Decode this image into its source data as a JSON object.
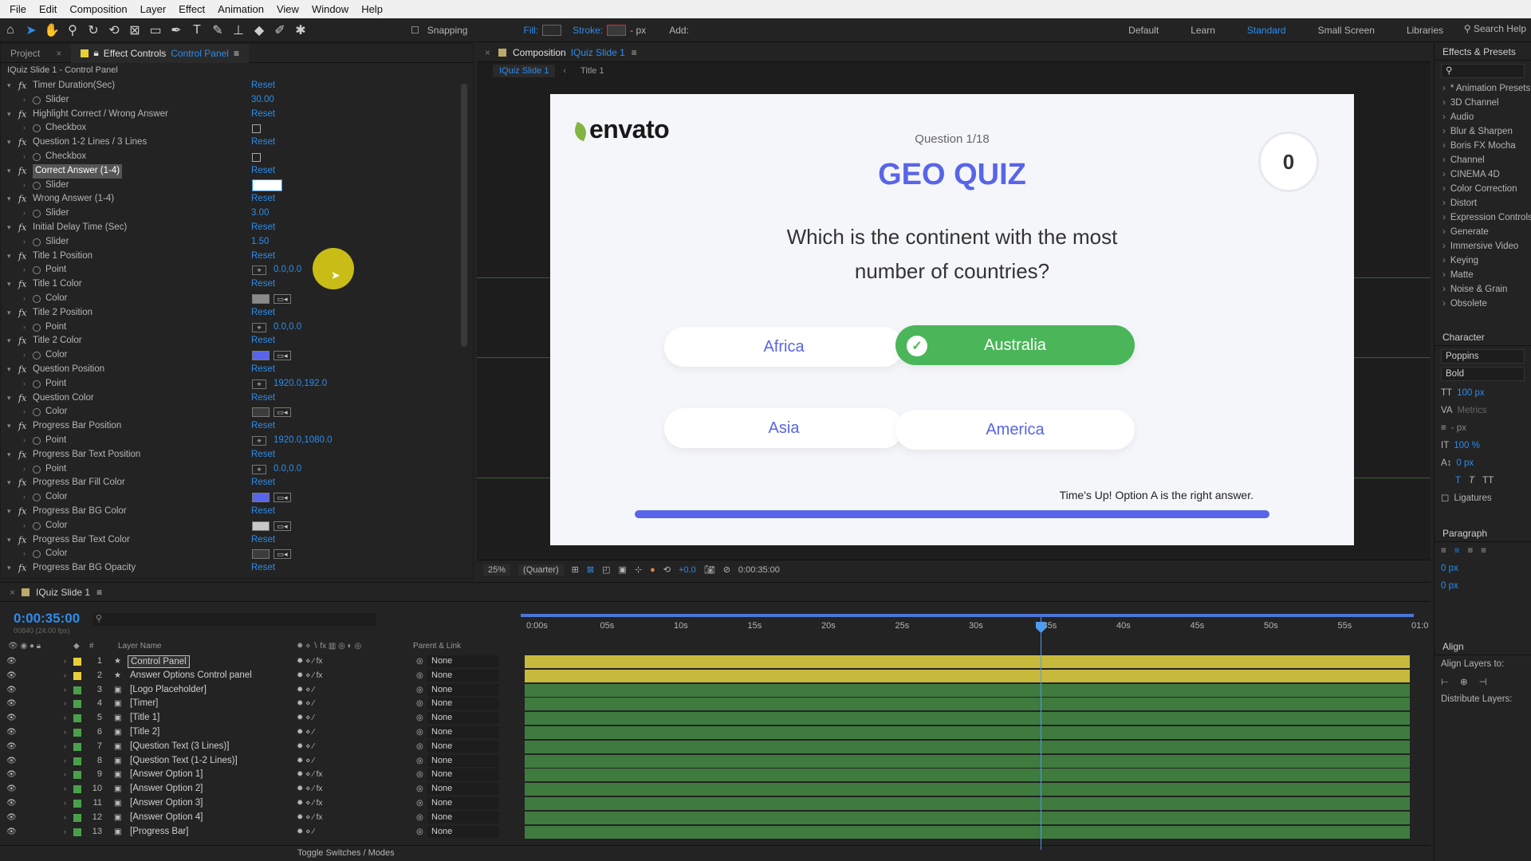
{
  "menu": [
    "File",
    "Edit",
    "Composition",
    "Layer",
    "Effect",
    "Animation",
    "View",
    "Window",
    "Help"
  ],
  "toolbar": {
    "snapping": "Snapping",
    "fill": "Fill:",
    "stroke": "Stroke:",
    "px": "- px",
    "add": "Add:",
    "workspaces": [
      "Default",
      "Learn",
      "Standard",
      "Small Screen",
      "Libraries"
    ],
    "active_workspace": "Standard",
    "search_help": "Search Help"
  },
  "effect_controls": {
    "tab_project": "Project",
    "tab_label": "Effect Controls",
    "tab_layer": "Control Panel",
    "layer_title": "IQuiz Slide 1 - Control Panel",
    "reset": "Reset",
    "effects": [
      {
        "name": "Timer Duration(Sec)",
        "prop": "Slider",
        "type": "value",
        "value": "30.00"
      },
      {
        "name": "Highlight Correct / Wrong Answer",
        "prop": "Checkbox",
        "type": "checkbox"
      },
      {
        "name": "Question 1-2 Lines / 3 Lines",
        "prop": "Checkbox",
        "type": "checkbox"
      },
      {
        "name": "Correct Answer (1-4)",
        "prop": "Slider",
        "type": "editing",
        "highlight": true
      },
      {
        "name": "Wrong Answer (1-4)",
        "prop": "Slider",
        "type": "value",
        "value": "3.00"
      },
      {
        "name": "Initial Delay Time (Sec)",
        "prop": "Slider",
        "type": "value",
        "value": "1.50"
      },
      {
        "name": "Title 1 Position",
        "prop": "Point",
        "type": "point",
        "value": "0.0,0.0"
      },
      {
        "name": "Title 1 Color",
        "prop": "Color",
        "type": "color",
        "color": "#8a8a8a"
      },
      {
        "name": "Title 2 Position",
        "prop": "Point",
        "type": "point",
        "value": "0.0,0.0"
      },
      {
        "name": "Title 2 Color",
        "prop": "Color",
        "type": "color",
        "color": "#5865e8"
      },
      {
        "name": "Question Position",
        "prop": "Point",
        "type": "point",
        "value": "1920.0,192.0"
      },
      {
        "name": "Question Color",
        "prop": "Color",
        "type": "color",
        "color": "#3c3c3c"
      },
      {
        "name": "Progress Bar Position",
        "prop": "Point",
        "type": "point",
        "value": "1920.0,1080.0"
      },
      {
        "name": "Progress Bar Text Position",
        "prop": "Point",
        "type": "point",
        "value": "0.0,0.0"
      },
      {
        "name": "Progress Bar Fill Color",
        "prop": "Color",
        "type": "color",
        "color": "#5865e8"
      },
      {
        "name": "Progress Bar BG Color",
        "prop": "Color",
        "type": "color",
        "color": "#c8c8c8"
      },
      {
        "name": "Progress Bar Text Color",
        "prop": "Color",
        "type": "color",
        "color": "#3c3c3c"
      },
      {
        "name": "Progress Bar BG Opacity",
        "prop": "",
        "type": "none"
      }
    ]
  },
  "composition": {
    "tab_label": "Composition",
    "comp_name": "IQuiz Slide 1",
    "crumb_active": "IQuiz Slide 1",
    "crumb_next": "Title 1",
    "zoom": "25%",
    "resolution": "(Quarter)",
    "exposure": "+0.0",
    "timecode": "0:00:35:00"
  },
  "quiz": {
    "logo": "envato",
    "question_count": "Question 1/18",
    "title": "GEO QUIZ",
    "score": "0",
    "question_line1": "Which is the continent with the most",
    "question_line2": "number of countries?",
    "options": [
      "Africa",
      "Australia",
      "Asia",
      "America"
    ],
    "correct_option": "Australia",
    "answer_text": "Time's Up! Option A is the right answer.",
    "accent": "#5865e8",
    "correct_color": "#4ab659"
  },
  "effects_presets": {
    "title": "Effects & Presets",
    "items": [
      "* Animation Presets",
      "3D Channel",
      "Audio",
      "Blur & Sharpen",
      "Boris FX Mocha",
      "Channel",
      "CINEMA 4D",
      "Color Correction",
      "Distort",
      "Expression Controls",
      "Generate",
      "Immersive Video",
      "Keying",
      "Matte",
      "Noise & Grain",
      "Obsolete"
    ]
  },
  "character": {
    "title": "Character",
    "font": "Poppins",
    "style": "Bold",
    "size": "100 px",
    "metrics": "Metrics",
    "px": "- px",
    "vscale": "100 %",
    "baseline": "0 px",
    "ligatures": "Ligatures"
  },
  "paragraph": {
    "title": "Paragraph",
    "indent1": "0 px",
    "indent2": "0 px"
  },
  "align": {
    "title": "Align",
    "align_to": "Align Layers to:",
    "distribute": "Distribute Layers:"
  },
  "timeline": {
    "tab": "IQuiz Slide 1",
    "timecode": "0:00:35:00",
    "fps": "00840 (24.00 fps)",
    "col_layer_name": "Layer Name",
    "col_parent": "Parent & Link",
    "ticks": [
      "0:00s",
      "05s",
      "10s",
      "15s",
      "20s",
      "25s",
      "30s",
      "35s",
      "40s",
      "45s",
      "50s",
      "55s",
      "01:0"
    ],
    "layers": [
      {
        "num": "1",
        "name": "Control Panel",
        "color": "#e8cf3a",
        "bar": "yellow",
        "selected": true
      },
      {
        "num": "2",
        "name": "Answer Options Control panel",
        "color": "#e8cf3a",
        "bar": "yellow"
      },
      {
        "num": "3",
        "name": "[Logo Placeholder]",
        "color": "#4aa04a",
        "bar": "green"
      },
      {
        "num": "4",
        "name": "[Timer]",
        "color": "#4aa04a",
        "bar": "green"
      },
      {
        "num": "5",
        "name": "[Title 1]",
        "color": "#4aa04a",
        "bar": "green"
      },
      {
        "num": "6",
        "name": "[Title 2]",
        "color": "#4aa04a",
        "bar": "green"
      },
      {
        "num": "7",
        "name": "[Question Text (3 Lines)]",
        "color": "#4aa04a",
        "bar": "green"
      },
      {
        "num": "8",
        "name": "[Question Text (1-2 Lines)]",
        "color": "#4aa04a",
        "bar": "green"
      },
      {
        "num": "9",
        "name": "[Answer Option 1]",
        "color": "#4aa04a",
        "bar": "green"
      },
      {
        "num": "10",
        "name": "[Answer Option 2]",
        "color": "#4aa04a",
        "bar": "green"
      },
      {
        "num": "11",
        "name": "[Answer Option 3]",
        "color": "#4aa04a",
        "bar": "green"
      },
      {
        "num": "12",
        "name": "[Answer Option 4]",
        "color": "#4aa04a",
        "bar": "green"
      },
      {
        "num": "13",
        "name": "[Progress Bar]",
        "color": "#4aa04a",
        "bar": "green"
      }
    ],
    "parent_value": "None",
    "footer": "Toggle Switches / Modes"
  }
}
